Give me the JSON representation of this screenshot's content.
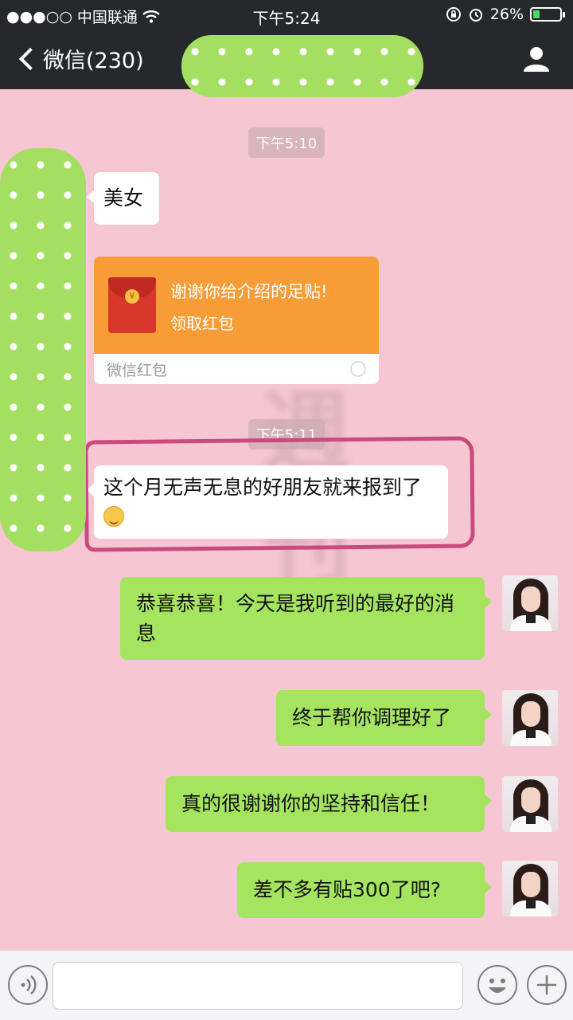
{
  "status_bar": {
    "signal": "●●●○○",
    "carrier": "中国联通",
    "time": "下午5:24",
    "battery_percent": "26%",
    "battery_level": 0.26
  },
  "nav": {
    "back_label": "微信(230)"
  },
  "messages": {
    "timestamp_1": "下午5:10",
    "msg_1": "美女",
    "red_packet": {
      "title": "谢谢你给介绍的足贴!",
      "action": "领取红包",
      "brand": "微信红包",
      "coin_symbol": "¥"
    },
    "timestamp_2": "下午5:11",
    "msg_2": "这个月无声无息的好朋友就来报到了",
    "reply_1": "恭喜恭喜！今天是我听到的最好的消息",
    "reply_2": "终于帮你调理好了",
    "reply_3": "真的很谢谢你的坚持和信任！",
    "reply_4": "差不多有贴300了吧?"
  },
  "colors": {
    "chat_background": "#f6c6d2",
    "header_background": "#26282c",
    "outgoing_bubble": "#a5e45f",
    "red_packet": "#f79c37",
    "highlight_ring": "#c94a7c"
  }
}
